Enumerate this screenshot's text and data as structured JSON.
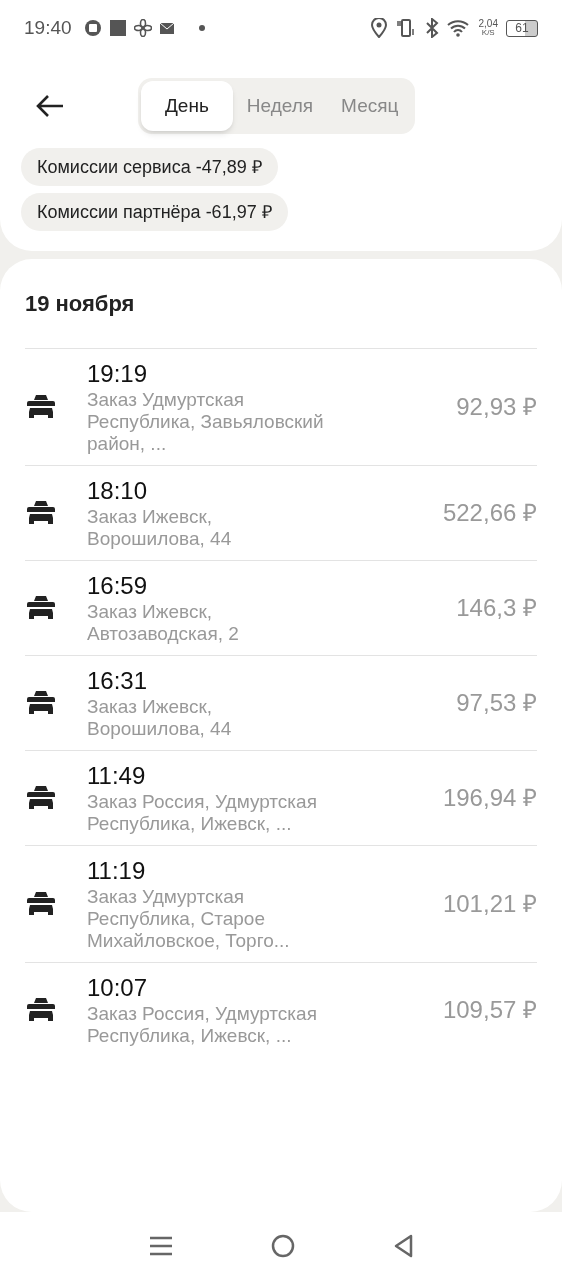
{
  "status_bar": {
    "time": "19:40",
    "speed": "2,04",
    "speed_unit": "K/S",
    "battery": "61"
  },
  "tabs": [
    {
      "label": "День",
      "selected": true
    },
    {
      "label": "Неделя",
      "selected": false
    },
    {
      "label": "Месяц",
      "selected": false
    }
  ],
  "commissions": [
    "Комиссии сервиса -47,89 ₽",
    "Комиссии партнёра -61,97 ₽"
  ],
  "date": "19 ноября",
  "orders": [
    {
      "time": "19:19",
      "address": "Заказ Удмуртская Республика, Завьяловский район, ...",
      "amount": "92,93 ₽"
    },
    {
      "time": "18:10",
      "address": "Заказ Ижевск, Ворошилова, 44",
      "amount": "522,66 ₽"
    },
    {
      "time": "16:59",
      "address": "Заказ Ижевск, Автозаводская, 2",
      "amount": "146,3 ₽"
    },
    {
      "time": "16:31",
      "address": "Заказ Ижевск, Ворошилова, 44",
      "amount": "97,53 ₽"
    },
    {
      "time": "11:49",
      "address": "Заказ Россия, Удмуртская Республика, Ижевск, ...",
      "amount": "196,94 ₽"
    },
    {
      "time": "11:19",
      "address": "Заказ Удмуртская Республика, Старое Михайловское, Торго...",
      "amount": "101,21 ₽"
    },
    {
      "time": "10:07",
      "address": "Заказ Россия, Удмуртская Республика, Ижевск, ...",
      "amount": "109,57 ₽"
    }
  ]
}
